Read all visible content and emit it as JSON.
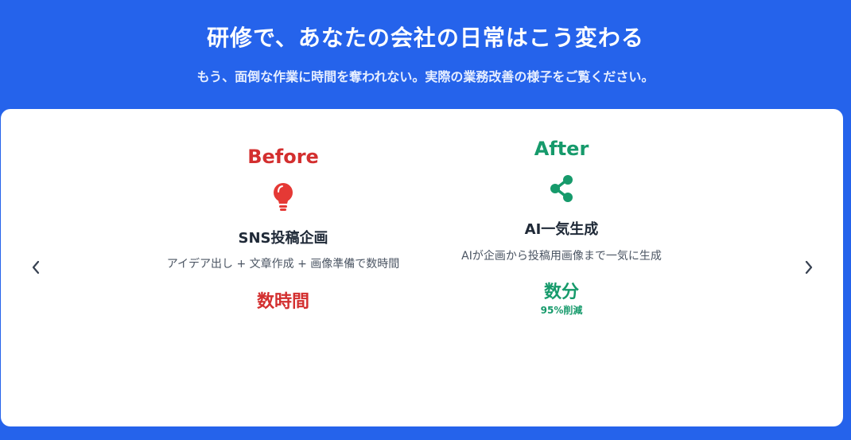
{
  "header": {
    "title": "研修で、あなたの会社の日常はこう変わる",
    "subtitle": "もう、面倒な作業に時間を奪われない。実際の業務改善の様子をご覧ください。"
  },
  "slide": {
    "before": {
      "label": "Before",
      "icon": "lightbulb-icon",
      "title": "SNS投稿企画",
      "description": "アイデア出し + 文章作成 + 画像準備で数時間",
      "time": "数時間"
    },
    "after": {
      "label": "After",
      "icon": "share-icon",
      "title": "AI一気生成",
      "description": "AIが企画から投稿用画像まで一気に生成",
      "time": "数分",
      "reduction": "95%削減"
    }
  },
  "nav": {
    "prev_icon": "chevron-left-icon",
    "next_icon": "chevron-right-icon"
  },
  "colors": {
    "background": "#2563eb",
    "before_red": "#d32f2f",
    "after_green": "#169a6b",
    "card": "#ffffff"
  }
}
